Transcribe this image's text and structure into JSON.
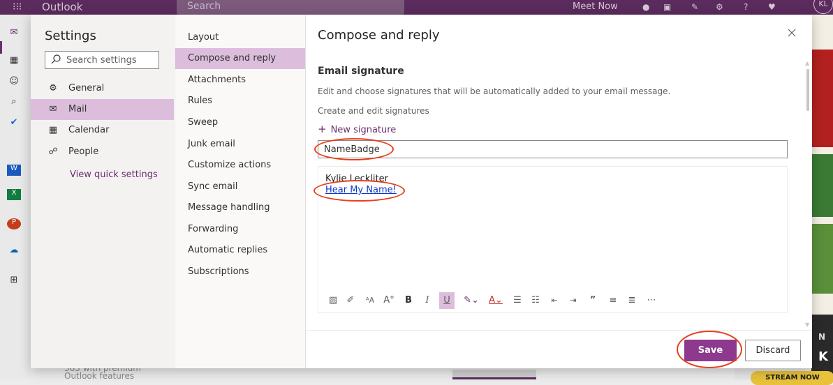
{
  "app": {
    "name": "Outlook",
    "search_placeholder": "Search",
    "meet_now": "Meet Now",
    "avatar_initials": "KL"
  },
  "background": {
    "bottom_text_1": "365 with premium",
    "bottom_text_2": "Outlook features",
    "ad_stream_label": "STREAM NOW",
    "ad_letter_n": "N",
    "ad_letter_k": "K"
  },
  "settings": {
    "title": "Settings",
    "search_placeholder": "Search settings",
    "nav": [
      {
        "label": "General",
        "icon": "gear-icon"
      },
      {
        "label": "Mail",
        "icon": "mail-icon"
      },
      {
        "label": "Calendar",
        "icon": "calendar-icon"
      },
      {
        "label": "People",
        "icon": "people-icon"
      }
    ],
    "view_quick_settings": "View quick settings"
  },
  "mail_nav": [
    "Layout",
    "Compose and reply",
    "Attachments",
    "Rules",
    "Sweep",
    "Junk email",
    "Customize actions",
    "Sync email",
    "Message handling",
    "Forwarding",
    "Automatic replies",
    "Subscriptions"
  ],
  "selected": {
    "settings_nav": "Mail",
    "mail_nav": "Compose and reply"
  },
  "content": {
    "title": "Compose and reply",
    "section_title": "Email signature",
    "description": "Edit and choose signatures that will be automatically added to your email message.",
    "create_label": "Create and edit signatures",
    "new_signature": "New signature",
    "signature_name": "NameBadge",
    "signature_body_name": "Kylie Leckliter",
    "signature_body_link": "Hear My Name!",
    "save_label": "Save",
    "discard_label": "Discard"
  },
  "toolbar": [
    "insert-image-icon",
    "format-painter-icon",
    "font-size-icon",
    "superscript-icon",
    "bold-icon",
    "italic-icon",
    "underline-icon",
    "highlight-icon",
    "font-color-icon",
    "bullets-icon",
    "numbering-icon",
    "decrease-indent-icon",
    "increase-indent-icon",
    "quote-icon",
    "align-left-icon",
    "align-center-icon",
    "more-icon"
  ],
  "colors": {
    "brand": "#5a2b5c",
    "accent": "#8d3a8e",
    "selected_bg": "#dcbedc",
    "link": "#0b38c9",
    "annotation": "#e8401c"
  }
}
